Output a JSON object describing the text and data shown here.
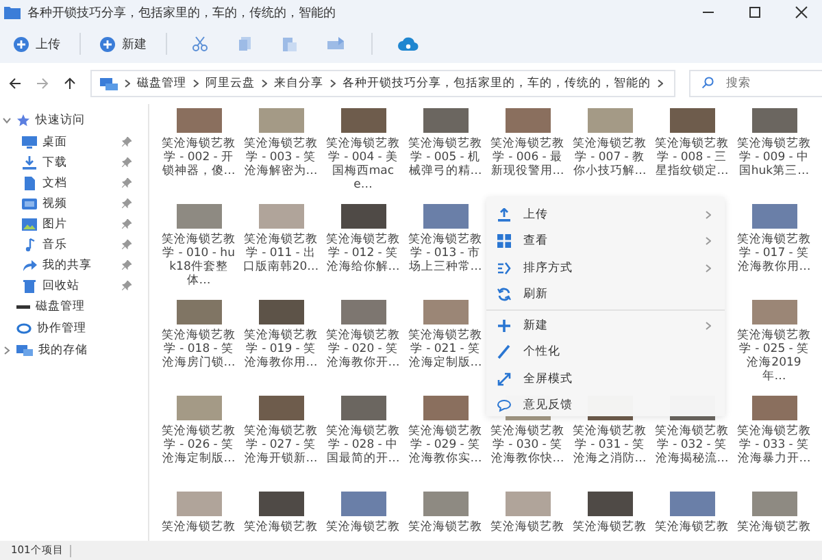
{
  "window": {
    "title": "各种开锁技巧分享，包括家里的，车的，传统的，智能的"
  },
  "toolbar": {
    "buttons": [
      {
        "label": "上传"
      },
      {
        "label": "新建"
      }
    ]
  },
  "address": {
    "crumbs": [
      "磁盘管理",
      "阿里云盘",
      "来自分享",
      "各种开锁技巧分享，包括家里的，车的，传统的，智能的"
    ],
    "search": {
      "placeholder": "搜索"
    }
  },
  "sidebar": {
    "items": [
      {
        "label": "快速访问",
        "expanded": true,
        "children": [
          {
            "label": "桌面",
            "pinned": true
          },
          {
            "label": "下载",
            "pinned": true
          },
          {
            "label": "文档",
            "pinned": true
          },
          {
            "label": "视频",
            "pinned": true
          },
          {
            "label": "图片",
            "pinned": true
          },
          {
            "label": "音乐",
            "pinned": true
          },
          {
            "label": "我的共享",
            "pinned": true
          },
          {
            "label": "回收站",
            "pinned": true
          }
        ]
      },
      {
        "label": "磁盘管理"
      },
      {
        "label": "协作管理"
      },
      {
        "label": "我的存储",
        "expanded": false
      }
    ]
  },
  "grid": {
    "rows": [
      {
        "items": [
          {
            "kind": "file",
            "label": "笑沧海锁艺教学 - 002 - 开锁神器，傻…"
          },
          {
            "kind": "file",
            "label": "笑沧海锁艺教学 - 003 - 笑沧海解密为…"
          },
          {
            "kind": "file",
            "label": "笑沧海锁艺教学 - 004 - 美国梅西mace…"
          },
          {
            "kind": "file",
            "label": "笑沧海锁艺教学 - 005 - 机械弹弓的精…"
          },
          {
            "kind": "file",
            "label": "笑沧海锁艺教学 - 006 - 最新现役警用…"
          },
          {
            "kind": "file",
            "label": "笑沧海锁艺教学 - 007 - 教你小技巧解…"
          },
          {
            "kind": "file",
            "label": "笑沧海锁艺教学 - 008 - 三星指纹锁定…"
          },
          {
            "kind": "file",
            "label": "笑沧海锁艺教学 - 009 - 中国huk第三…"
          }
        ]
      },
      {
        "items": [
          {
            "kind": "file",
            "label": "笑沧海锁艺教学 - 010 - huk18件套整体…"
          },
          {
            "kind": "file",
            "label": "笑沧海锁艺教学 - 011 - 出口版南韩20…"
          },
          {
            "kind": "file",
            "label": "笑沧海锁艺教学 - 012 - 笑沧海给你解…"
          },
          {
            "kind": "file",
            "label": "笑沧海锁艺教学 - 013 - 市场上三种常…"
          },
          {
            "kind": "covered"
          },
          {
            "kind": "covered"
          },
          {
            "kind": "covered"
          },
          {
            "kind": "file",
            "label": "笑沧海锁艺教学 - 017 - 笑沧海教你用…"
          }
        ]
      },
      {
        "items": [
          {
            "kind": "file",
            "label": "笑沧海锁艺教学 - 018 - 笑沧海房门锁…"
          },
          {
            "kind": "file",
            "label": "笑沧海锁艺教学 - 019 - 笑沧海教你用…"
          },
          {
            "kind": "file",
            "label": "笑沧海锁艺教学 - 020 - 笑沧海教你开…"
          },
          {
            "kind": "file",
            "label": "笑沧海锁艺教学 - 021 - 笑沧海定制版…"
          },
          {
            "kind": "covered"
          },
          {
            "kind": "covered"
          },
          {
            "kind": "covered"
          },
          {
            "kind": "file",
            "label": "笑沧海锁艺教学 - 025 - 笑沧海2019年…"
          }
        ]
      },
      {
        "items": [
          {
            "kind": "file",
            "label": "笑沧海锁艺教学 - 026 - 笑沧海定制版…"
          },
          {
            "kind": "file",
            "label": "笑沧海锁艺教学 - 027 - 笑沧海开锁新…"
          },
          {
            "kind": "file",
            "label": "笑沧海锁艺教学 - 028 - 中国最简的开…"
          },
          {
            "kind": "file",
            "label": "笑沧海锁艺教学 - 029 - 笑沧海教你实…"
          },
          {
            "kind": "file",
            "label": "笑沧海锁艺教学 - 030 - 笑沧海教你快…"
          },
          {
            "kind": "file",
            "label": "笑沧海锁艺教学 - 031 - 笑沧海之消防…"
          },
          {
            "kind": "file",
            "label": "笑沧海锁艺教学 - 032 - 笑沧海揭秘流…"
          },
          {
            "kind": "file",
            "label": "笑沧海锁艺教学 - 033 - 笑沧海暴力开…"
          }
        ]
      },
      {
        "items": [
          {
            "kind": "file",
            "label": "笑沧海锁艺教"
          },
          {
            "kind": "file",
            "label": "笑沧海锁艺教"
          },
          {
            "kind": "file",
            "label": "笑沧海锁艺教"
          },
          {
            "kind": "file",
            "label": "笑沧海锁艺教"
          },
          {
            "kind": "file",
            "label": "笑沧海锁艺教"
          },
          {
            "kind": "file",
            "label": "笑沧海锁艺教"
          },
          {
            "kind": "file",
            "label": "笑沧海锁艺教"
          },
          {
            "kind": "file",
            "label": "笑沧海锁艺教"
          }
        ]
      }
    ]
  },
  "context_menu": {
    "items": [
      {
        "kind": "upload",
        "label": "上传",
        "submenu": true
      },
      {
        "kind": "view",
        "label": "查看",
        "submenu": true
      },
      {
        "kind": "sort",
        "label": "排序方式",
        "submenu": true
      },
      {
        "kind": "refresh",
        "label": "刷新",
        "submenu": false
      },
      {
        "kind": "new",
        "label": "新建",
        "submenu": true
      },
      {
        "kind": "personalize",
        "label": "个性化",
        "submenu": false
      },
      {
        "kind": "fullscreen",
        "label": "全屏模式",
        "submenu": false
      },
      {
        "kind": "feedback",
        "label": "意见反馈",
        "submenu": false
      }
    ]
  },
  "status_bar": {
    "count": "101个项目"
  }
}
